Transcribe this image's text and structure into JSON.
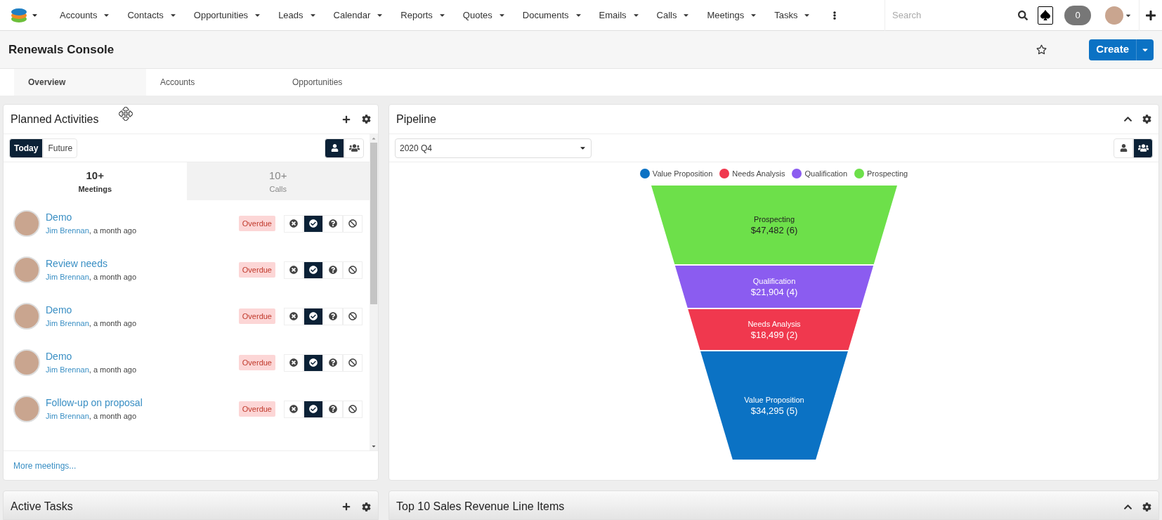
{
  "nav": {
    "items": [
      {
        "label": "Accounts"
      },
      {
        "label": "Contacts"
      },
      {
        "label": "Opportunities"
      },
      {
        "label": "Leads"
      },
      {
        "label": "Calendar"
      },
      {
        "label": "Reports"
      },
      {
        "label": "Quotes"
      },
      {
        "label": "Documents"
      },
      {
        "label": "Emails"
      },
      {
        "label": "Calls"
      },
      {
        "label": "Meetings"
      },
      {
        "label": "Tasks"
      }
    ],
    "search": {
      "placeholder": "Search"
    },
    "notifications": "0"
  },
  "header": {
    "title": "Renewals Console",
    "create_button": "Create"
  },
  "tabs": [
    {
      "label": "Overview",
      "selected": true
    },
    {
      "label": "Accounts",
      "selected": false
    },
    {
      "label": "Opportunities",
      "selected": false
    }
  ],
  "planned_activities": {
    "title": "Planned Activities",
    "period_toggle": [
      {
        "label": "Today",
        "selected": true
      },
      {
        "label": "Future",
        "selected": false
      }
    ],
    "view_toggle": [
      {
        "kind": "user",
        "selected": true
      },
      {
        "kind": "team",
        "selected": false
      }
    ],
    "type_tabs": [
      {
        "count": "10+",
        "label": "Meetings",
        "selected": true
      },
      {
        "count": "10+",
        "label": "Calls",
        "selected": false
      }
    ],
    "rows": [
      {
        "title": "Demo",
        "user": "Jim Brennan",
        "time": ", a month ago",
        "badge": "Overdue",
        "responses": [
          {
            "kind": "decline",
            "selected": false
          },
          {
            "kind": "accept",
            "selected": true
          },
          {
            "kind": "tentative",
            "selected": false
          },
          {
            "kind": "none",
            "selected": false
          }
        ]
      },
      {
        "title": "Review needs",
        "user": "Jim Brennan",
        "time": ", a month ago",
        "badge": "Overdue",
        "responses": [
          {
            "kind": "decline",
            "selected": false
          },
          {
            "kind": "accept",
            "selected": true
          },
          {
            "kind": "tentative",
            "selected": false
          },
          {
            "kind": "none",
            "selected": false
          }
        ]
      },
      {
        "title": "Demo",
        "user": "Jim Brennan",
        "time": ", a month ago",
        "badge": "Overdue",
        "responses": [
          {
            "kind": "decline",
            "selected": false
          },
          {
            "kind": "accept",
            "selected": true
          },
          {
            "kind": "tentative",
            "selected": false
          },
          {
            "kind": "none",
            "selected": false
          }
        ]
      },
      {
        "title": "Demo",
        "user": "Jim Brennan",
        "time": ", a month ago",
        "badge": "Overdue",
        "responses": [
          {
            "kind": "decline",
            "selected": false
          },
          {
            "kind": "accept",
            "selected": true
          },
          {
            "kind": "tentative",
            "selected": false
          },
          {
            "kind": "none",
            "selected": false
          }
        ]
      },
      {
        "title": "Follow-up on proposal",
        "user": "Jim Brennan",
        "time": ", a month ago",
        "badge": "Overdue",
        "responses": [
          {
            "kind": "decline",
            "selected": false
          },
          {
            "kind": "accept",
            "selected": true
          },
          {
            "kind": "tentative",
            "selected": false
          },
          {
            "kind": "none",
            "selected": false
          }
        ]
      }
    ],
    "more_link": "More meetings..."
  },
  "pipeline": {
    "title": "Pipeline",
    "period": "2020 Q4",
    "view_toggle": [
      {
        "kind": "user",
        "selected": false
      },
      {
        "kind": "team",
        "selected": true
      }
    ],
    "legend": [
      {
        "label": "Value Proposition",
        "color": "#0b72c4"
      },
      {
        "label": "Needs Analysis",
        "color": "#f0384e"
      },
      {
        "label": "Qualification",
        "color": "#8b5cf0"
      },
      {
        "label": "Prospecting",
        "color": "#6de04a"
      }
    ],
    "funnel_segments": [
      {
        "label": "Prospecting",
        "amount": "$47,482 (6)",
        "color": "#6de04a"
      },
      {
        "label": "Qualification",
        "amount": "$21,904 (4)",
        "color": "#8b5cf0"
      },
      {
        "label": "Needs Analysis",
        "amount": "$18,499 (2)",
        "color": "#f0384e"
      },
      {
        "label": "Value Proposition",
        "amount": "$34,295 (5)",
        "color": "#0b72c4"
      }
    ]
  },
  "active_tasks": {
    "title": "Active Tasks"
  },
  "top_sales": {
    "title": "Top 10 Sales Revenue Line Items"
  }
}
